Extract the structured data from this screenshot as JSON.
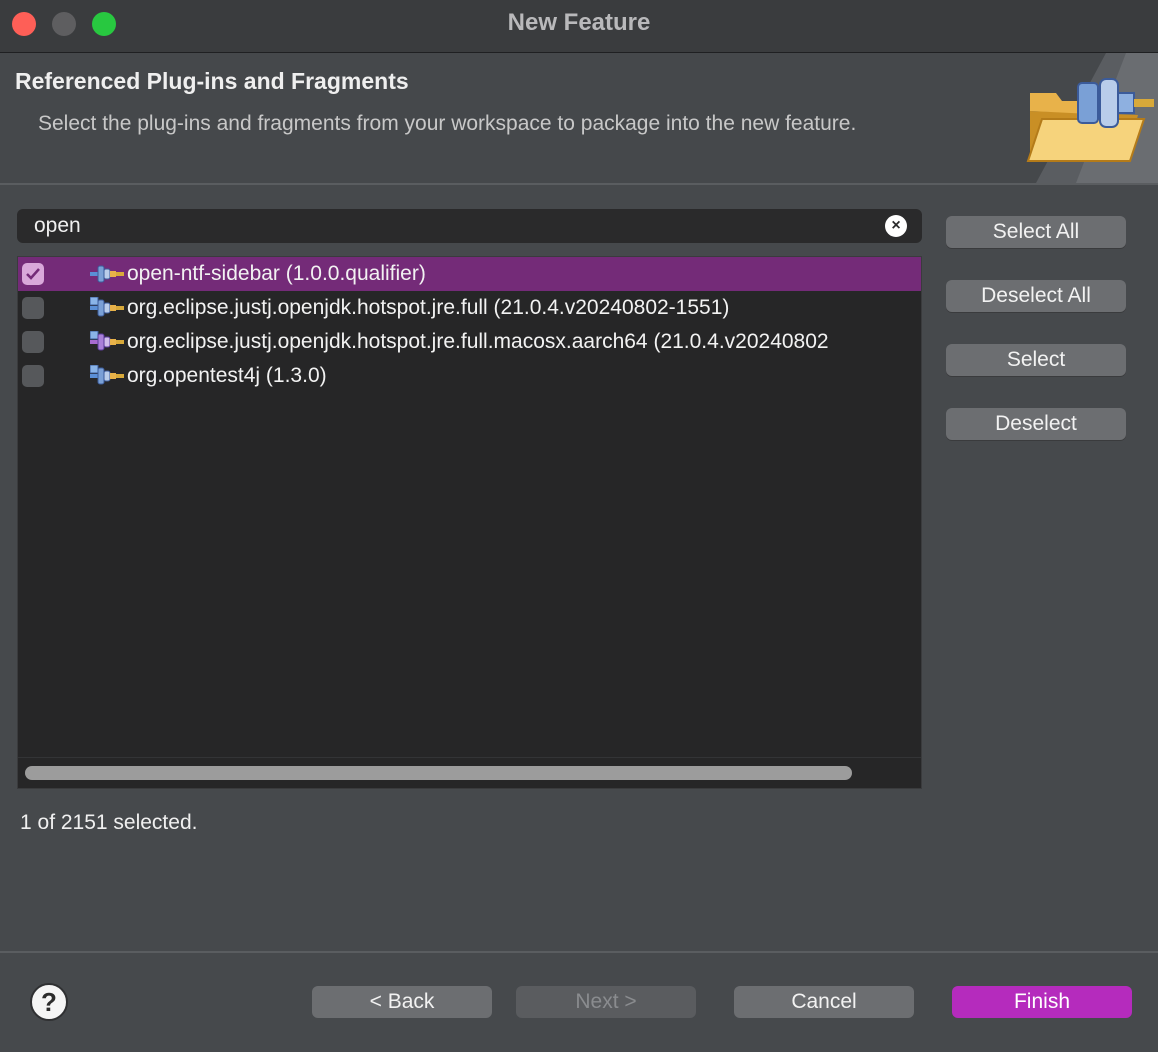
{
  "window": {
    "title": "New Feature"
  },
  "header": {
    "title": "Referenced Plug-ins and Fragments",
    "description": "Select the plug-ins and fragments from your workspace to package into the new feature."
  },
  "filter": {
    "value": "open",
    "clear_label": "×"
  },
  "items": [
    {
      "label": "open-ntf-sidebar (1.0.0.qualifier)",
      "checked": true
    },
    {
      "label": "org.eclipse.justj.openjdk.hotspot.jre.full (21.0.4.v20240802-1551)",
      "checked": false
    },
    {
      "label": "org.eclipse.justj.openjdk.hotspot.jre.full.macosx.aarch64 (21.0.4.v20240802",
      "checked": false
    },
    {
      "label": "org.opentest4j (1.3.0)",
      "checked": false
    }
  ],
  "side_buttons": {
    "select_all": "Select All",
    "deselect_all": "Deselect All",
    "select": "Select",
    "deselect": "Deselect"
  },
  "status": "1 of 2151 selected.",
  "footer": {
    "help": "?",
    "back": "< Back",
    "next": "Next >",
    "cancel": "Cancel",
    "finish": "Finish"
  }
}
